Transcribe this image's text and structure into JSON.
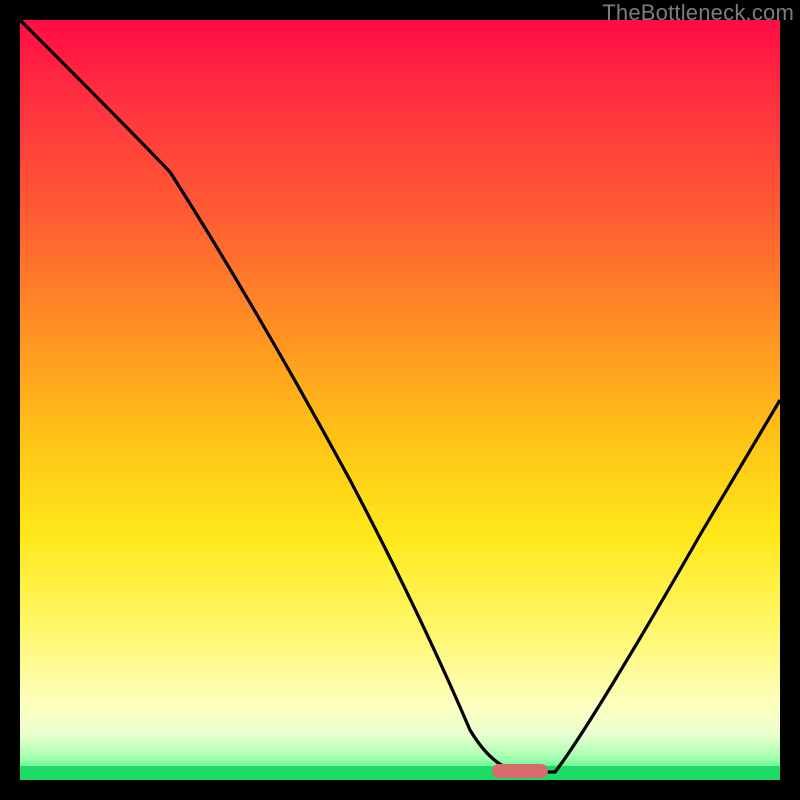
{
  "watermark": "TheBottleneck.com",
  "chart_data": {
    "type": "line",
    "title": "",
    "xlabel": "",
    "ylabel": "",
    "xlim": [
      0,
      100
    ],
    "ylim": [
      0,
      100
    ],
    "x": [
      0,
      10,
      20,
      30,
      40,
      50,
      58,
      62,
      66,
      70,
      80,
      90,
      100
    ],
    "values": [
      100,
      90,
      80,
      68,
      52,
      35,
      16,
      4,
      0,
      0,
      14,
      32,
      52
    ],
    "curve_description": "steep descent from top-left, kink near x≈20, valley bottoming out around x≈64–70 at y≈0, then rising linearly to the right edge",
    "marker": {
      "x": 65,
      "y": 0.5,
      "shape": "pill",
      "color": "#d86a6c"
    },
    "background_gradient": {
      "stops": [
        {
          "pct": 0,
          "color": "#ff0b45"
        },
        {
          "pct": 25,
          "color": "#ff5a33"
        },
        {
          "pct": 55,
          "color": "#ffc316"
        },
        {
          "pct": 80,
          "color": "#fff76a"
        },
        {
          "pct": 97,
          "color": "#a5ffb0"
        },
        {
          "pct": 100,
          "color": "#22e36b"
        }
      ]
    }
  }
}
